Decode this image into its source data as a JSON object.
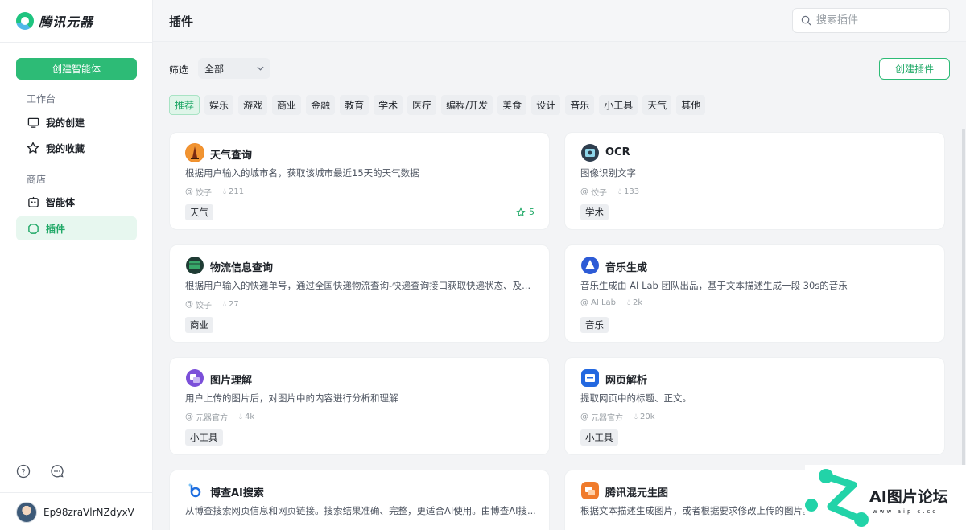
{
  "app": {
    "name": "腾讯元器"
  },
  "sidebar": {
    "create_button": "创建智能体",
    "workspace_label": "工作台",
    "store_label": "商店",
    "items": [
      {
        "label": "我的创建",
        "icon": "monitor-icon"
      },
      {
        "label": "我的收藏",
        "icon": "star-icon"
      },
      {
        "label": "智能体",
        "icon": "robot-icon"
      },
      {
        "label": "插件",
        "icon": "plugin-icon",
        "active": true
      }
    ],
    "user": {
      "name": "Ep98zraVlrNZdyxV"
    }
  },
  "header": {
    "title": "插件",
    "search_placeholder": "搜索插件"
  },
  "filter": {
    "label": "筛选",
    "selected": "全部",
    "create_button": "创建插件"
  },
  "tags": [
    "推荐",
    "娱乐",
    "游戏",
    "商业",
    "金融",
    "教育",
    "学术",
    "医疗",
    "编程/开发",
    "美食",
    "设计",
    "音乐",
    "小工具",
    "天气",
    "其他"
  ],
  "cards": [
    {
      "title": "天气查询",
      "desc": "根据用户输入的城市名，获取该城市最近15天的天气数据",
      "author": "饺子",
      "likes": "211",
      "tag": "天气",
      "favorites": "5"
    },
    {
      "title": "OCR",
      "desc": "图像识别文字",
      "author": "饺子",
      "likes": "133",
      "tag": "学术"
    },
    {
      "title": "物流信息查询",
      "desc": "根据用户输入的快递单号，通过全国快递物流查询-快递查询接口获取快递状态、及...",
      "author": "饺子",
      "likes": "27",
      "tag": "商业"
    },
    {
      "title": "音乐生成",
      "desc": "音乐生成由 AI Lab 团队出品，基于文本描述生成一段 30s的音乐",
      "author": "AI Lab",
      "likes": "2k",
      "tag": "音乐"
    },
    {
      "title": "图片理解",
      "desc": "用户上传的图片后，对图片中的内容进行分析和理解",
      "author": "元器官方",
      "likes": "4k",
      "tag": "小工具"
    },
    {
      "title": "网页解析",
      "desc": "提取网页中的标题、正文。",
      "author": "元器官方",
      "likes": "20k",
      "tag": "小工具"
    },
    {
      "title": "博查AI搜索",
      "desc": "从博查搜索网页信息和网页链接。搜索结果准确、完整，更适合AI使用。由博查AI搜..."
    },
    {
      "title": "腾讯混元生图",
      "desc": "根据文本描述生成图片，或者根据要求修改上传的图片。"
    }
  ],
  "watermark": {
    "title": "AI图片论坛",
    "url": "www.aipic.cc"
  }
}
